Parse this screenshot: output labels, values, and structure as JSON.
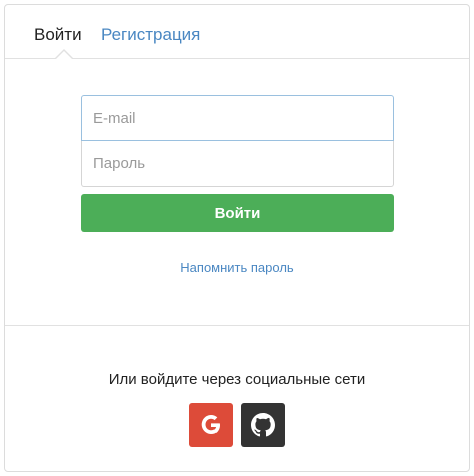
{
  "tabs": {
    "login_label": "Войти",
    "register_label": "Регистрация"
  },
  "form": {
    "email_value": "",
    "email_placeholder": "E-mail",
    "password_value": "",
    "password_placeholder": "Пароль",
    "submit_label": "Войти",
    "remind_link": "Напомнить пароль"
  },
  "social": {
    "prompt": "Или войдите через социальные сети",
    "buttons": [
      {
        "icon": "google-icon",
        "color": "#dd4b39"
      },
      {
        "icon": "github-icon",
        "color": "#333333"
      }
    ]
  },
  "colors": {
    "accent_link": "#4a87c2",
    "submit_green": "#4cae58"
  }
}
